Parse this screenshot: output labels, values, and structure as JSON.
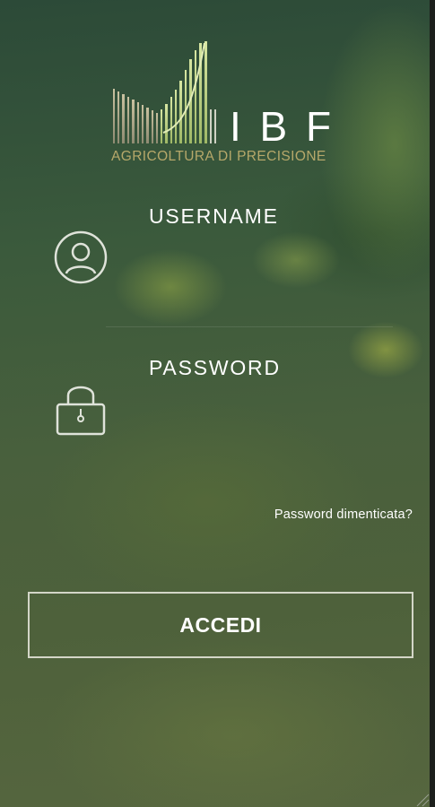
{
  "brand": {
    "letters": "I B F",
    "tagline": "AGRICOLTURA DI PRECISIONE",
    "letters_color": "#ffffff",
    "tagline_color": "#b6a86a",
    "logo_icon": "wheat-barcode-logo"
  },
  "login_form": {
    "username_label": "USERNAME",
    "username_value": "",
    "username_icon": "user-circle-icon",
    "password_label": "PASSWORD",
    "password_value": "",
    "password_icon": "padlock-icon",
    "forgot_password_link": "Password dimenticata?",
    "submit_label": "ACCEDI"
  },
  "colors": {
    "background": "#3f5a3b",
    "text": "#ffffff",
    "button_border": "#ebebe1"
  }
}
